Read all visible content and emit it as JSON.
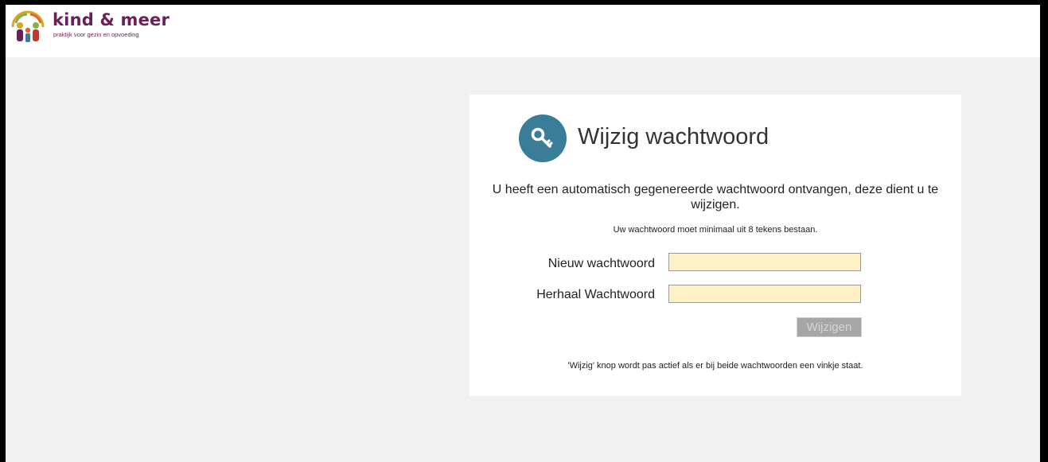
{
  "header": {
    "brand_name": "kind & meer",
    "tagline": "praktijk voor gezin en opvoeding"
  },
  "card": {
    "icon": "key-icon",
    "title": "Wijzig wachtwoord",
    "intro": "U heeft een automatisch gegenereerde wachtwoord ontvangen, deze dient u te wijzigen.",
    "note": "Uw wachtwoord moet minimaal uit 8 tekens bestaan.",
    "fields": {
      "new_password_label": "Nieuw wachtwoord",
      "new_password_value": "",
      "repeat_password_label": "Herhaal Wachtwoord",
      "repeat_password_value": ""
    },
    "submit_label": "Wijzigen",
    "submit_enabled": false,
    "hint": "'Wijzig' knop wordt pas actief als er bij beide wachtwoorden een vinkje staat."
  },
  "colors": {
    "accent": "#3a7d99",
    "brand": "#6b1f57",
    "input_background": "#fdf1c6",
    "page_background": "#f1f1f1"
  }
}
